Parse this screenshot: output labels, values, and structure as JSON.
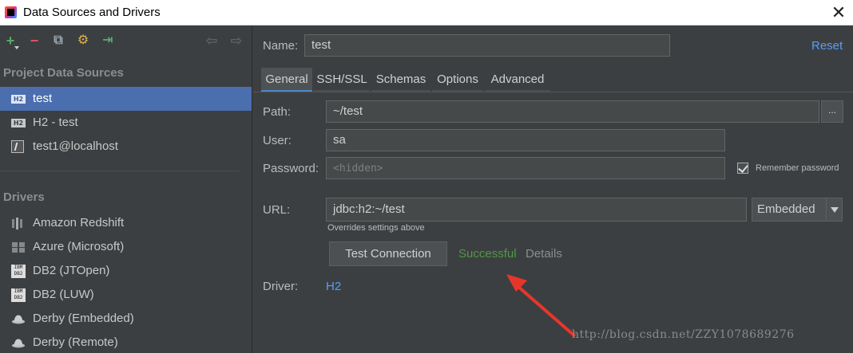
{
  "window": {
    "title": "Data Sources and Drivers",
    "close": "✕"
  },
  "toolbar": {
    "add": "+",
    "remove": "−",
    "copy": "⧉",
    "settings": "⚙",
    "import": "⇥",
    "back": "⇦",
    "forward": "⇨"
  },
  "sidebar": {
    "project_header": "Project Data Sources",
    "data_sources": [
      {
        "label": "test",
        "icon": "h2-icon",
        "badge": "H2"
      },
      {
        "label": "H2 - test",
        "icon": "h2-icon",
        "badge": "H2"
      },
      {
        "label": "test1@localhost",
        "icon": "mysql-icon"
      }
    ],
    "drivers_header": "Drivers",
    "drivers": [
      {
        "label": "Amazon Redshift",
        "icon": "redshift-icon"
      },
      {
        "label": "Azure (Microsoft)",
        "icon": "azure-icon"
      },
      {
        "label": "DB2 (JTOpen)",
        "icon": "db2-icon",
        "badge": "IBM DB2"
      },
      {
        "label": "DB2 (LUW)",
        "icon": "db2-icon",
        "badge": "IBM DB2"
      },
      {
        "label": "Derby (Embedded)",
        "icon": "derby-icon"
      },
      {
        "label": "Derby (Remote)",
        "icon": "derby-icon"
      }
    ]
  },
  "form": {
    "name_label": "Name:",
    "name_value": "test",
    "reset": "Reset",
    "tabs": [
      "General",
      "SSH/SSL",
      "Schemas",
      "Options",
      "Advanced"
    ],
    "path_label": "Path:",
    "path_value": "~/test",
    "browse": "...",
    "user_label": "User:",
    "user_value": "sa",
    "password_label": "Password:",
    "password_placeholder": "<hidden>",
    "remember_password": "Remember password",
    "url_label": "URL:",
    "url_value": "jdbc:h2:~/test",
    "url_mode": "Embedded",
    "overrides_note": "Overrides settings above",
    "test_connection": "Test Connection",
    "test_status": "Successful",
    "details": "Details",
    "driver_label": "Driver:",
    "driver_value": "H2"
  },
  "watermark": "http://blog.csdn.net/ZZY1078689276",
  "colors": {
    "accent": "#4b6eaf",
    "link": "#589df6",
    "success": "#4e9a3f",
    "arrow": "#e8352b"
  }
}
